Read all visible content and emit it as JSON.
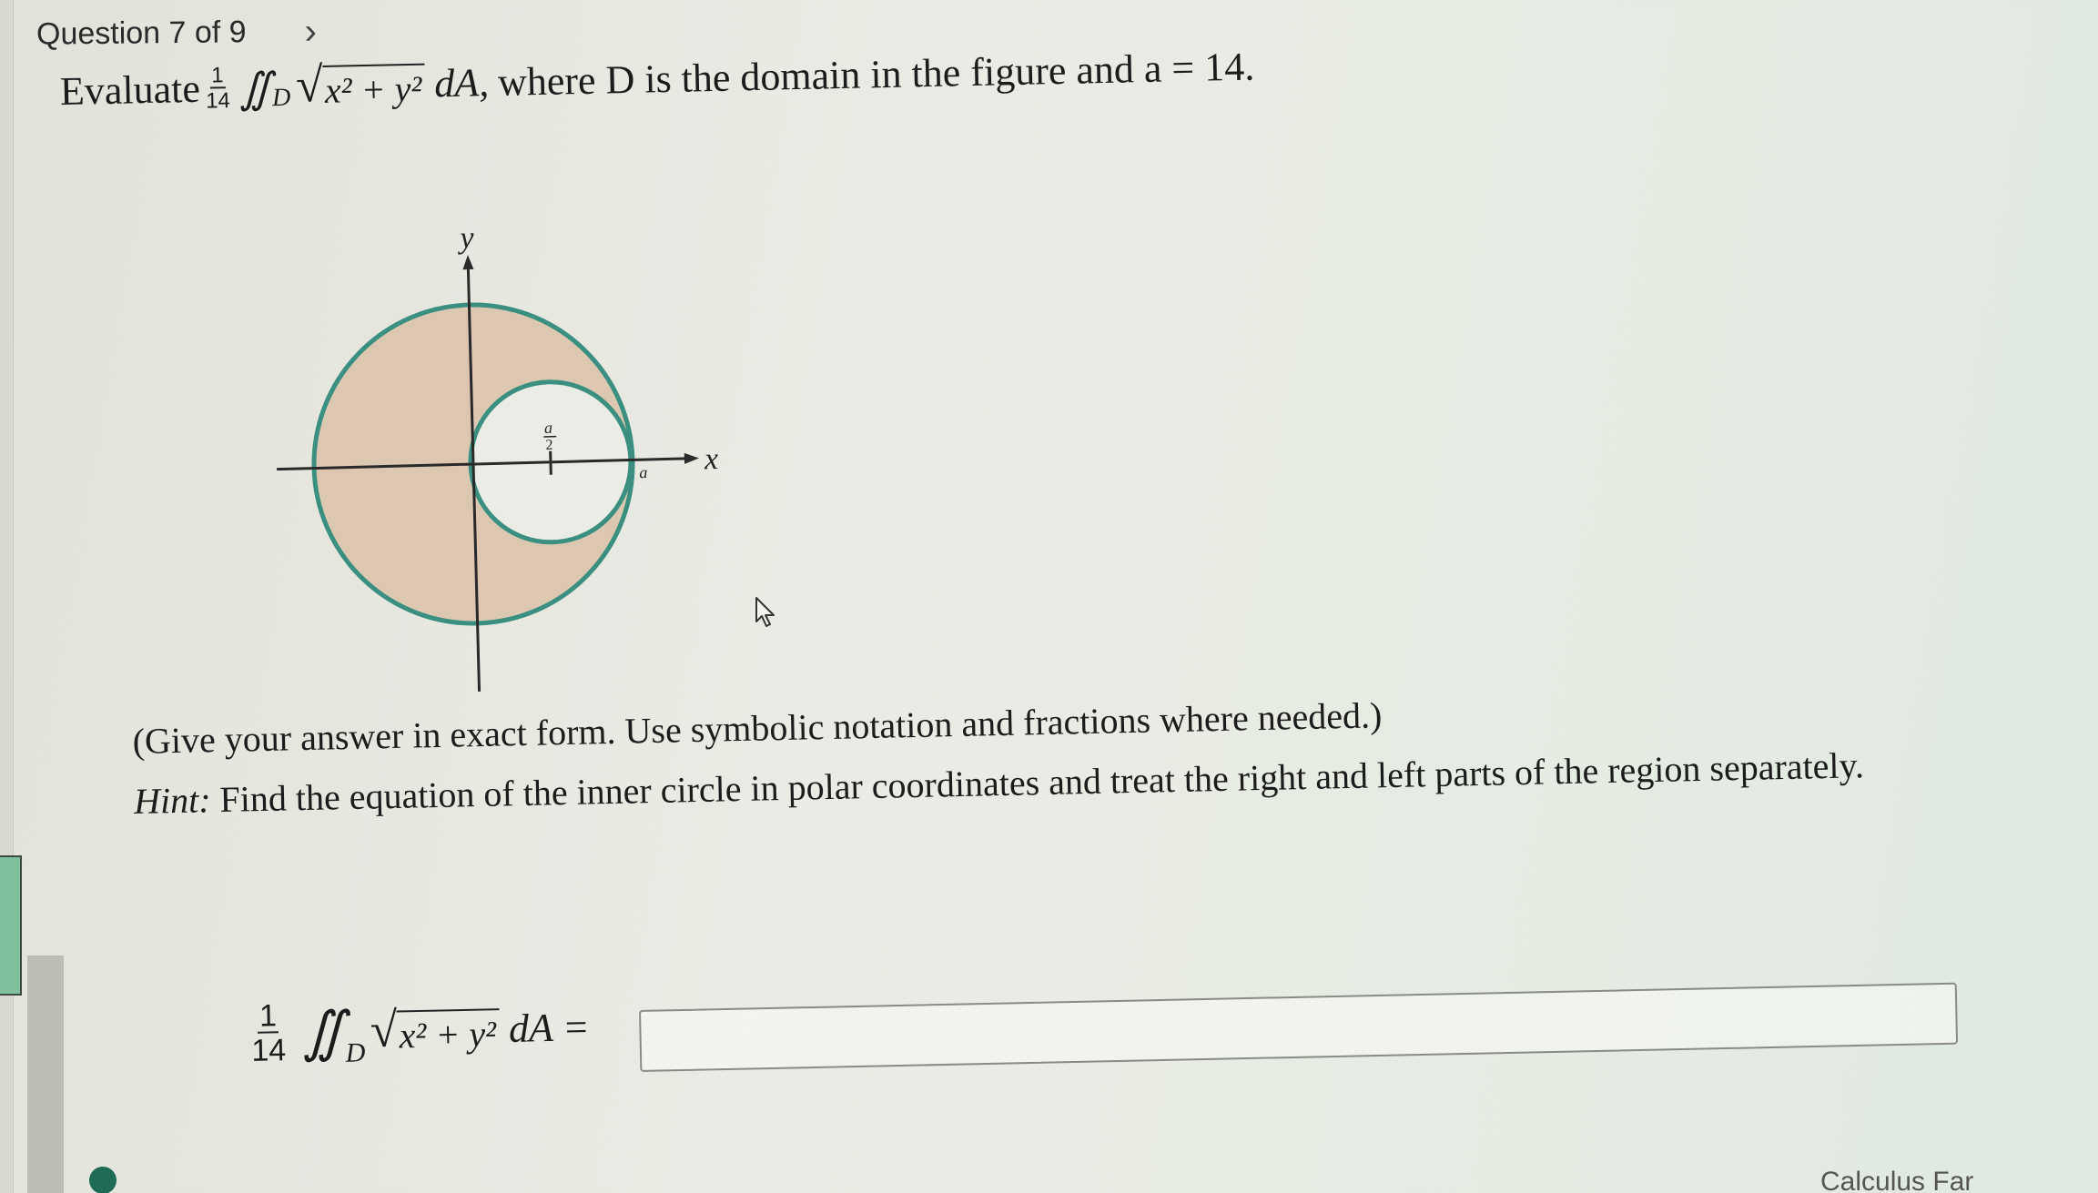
{
  "header": {
    "question_label": "Question 7 of 9",
    "next_icon": "chevron-right-icon"
  },
  "problem": {
    "evaluate_word": "Evaluate",
    "frac_num": "1",
    "frac_den": "14",
    "integral_symbol": "∬",
    "domain_sub": "D",
    "radicand": "x² + y²",
    "differential": "dA,",
    "rest_text": "where D is the domain in the figure and a = 14."
  },
  "figure": {
    "y_axis_label": "y",
    "x_axis_label": "x",
    "center_label_top": "a",
    "center_label_bottom": "2",
    "radius_label": "a",
    "region_fill": "#dcc8b0",
    "circle_stroke": "#3a8f80"
  },
  "instructions": {
    "line1": "(Give your answer in exact form. Use symbolic notation and fractions where needed.)",
    "hint_label": "Hint:",
    "hint_text": "Find the equation of the inner circle in polar coordinates and treat the right and left parts of the region separately."
  },
  "answer": {
    "frac_num": "1",
    "frac_den": "14",
    "integral_symbol": "∬",
    "domain_sub": "D",
    "radicand": "x² + y²",
    "differential": "dA =",
    "input_value": ""
  },
  "footer": {
    "link_text": "Calculus Far"
  }
}
